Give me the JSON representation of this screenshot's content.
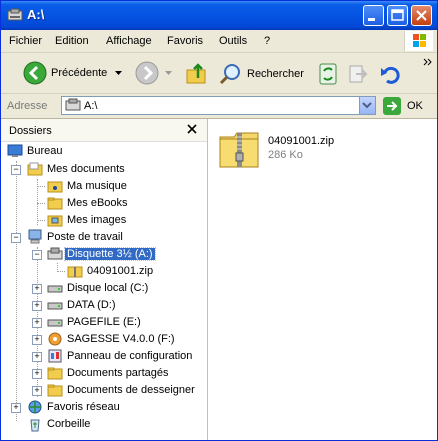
{
  "window": {
    "title": "A:\\"
  },
  "menu": [
    "Fichier",
    "Edition",
    "Affichage",
    "Favoris",
    "Outils",
    "?"
  ],
  "toolbar": {
    "back_label": "Précédente",
    "search_label": "Rechercher"
  },
  "address": {
    "label": "Adresse",
    "value": "A:\\",
    "go_label": "OK"
  },
  "folders": {
    "title": "Dossiers",
    "tree": [
      {
        "label": "Bureau"
      },
      {
        "label": "Mes documents"
      },
      {
        "label": "Ma musique"
      },
      {
        "label": "Mes eBooks"
      },
      {
        "label": "Mes images"
      },
      {
        "label": "Poste de travail"
      },
      {
        "label": "Disquette 3½ (A:)"
      },
      {
        "label": "04091001.zip"
      },
      {
        "label": "Disque local (C:)"
      },
      {
        "label": "DATA (D:)"
      },
      {
        "label": "PAGEFILE (E:)"
      },
      {
        "label": "SAGESSE V4.0.0 (F:)"
      },
      {
        "label": "Panneau de configuration"
      },
      {
        "label": "Documents partagés"
      },
      {
        "label": "Documents de desseigner"
      },
      {
        "label": "Favoris réseau"
      },
      {
        "label": "Corbeille"
      }
    ]
  },
  "files": [
    {
      "name": "04091001.zip",
      "size": "286 Ko"
    }
  ],
  "colors": {
    "titlebar": "#0553e2",
    "selection": "#316ac5",
    "chrome": "#ece9d8"
  }
}
